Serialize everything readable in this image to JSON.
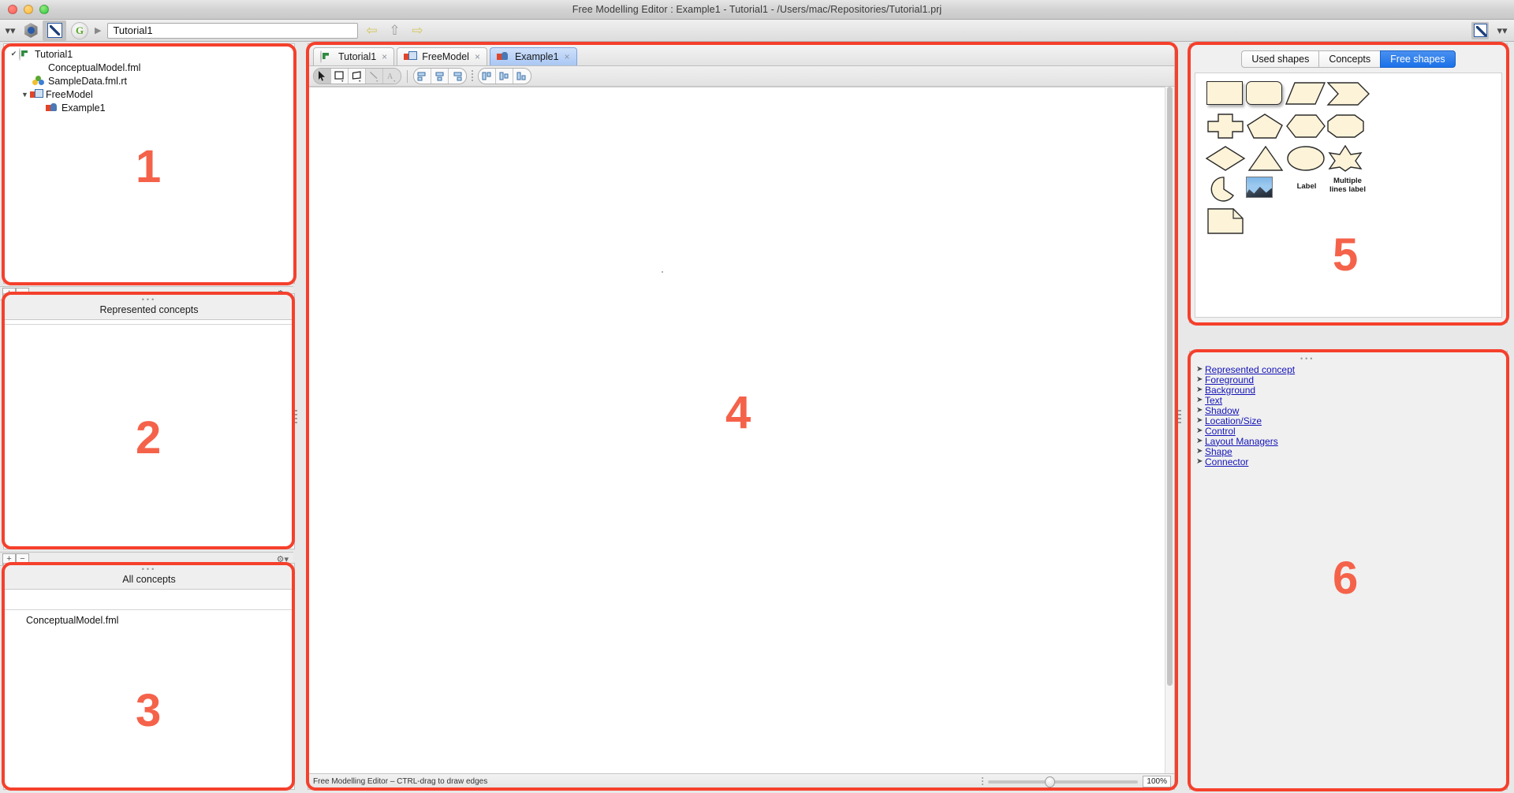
{
  "window": {
    "title": "Free Modelling Editor : Example1 - Tutorial1 - /Users/mac/Repositories/Tutorial1.prj"
  },
  "toolbar": {
    "path_value": "Tutorial1",
    "chevron_icon": "double-chevron-down-icon",
    "cube_icon": "cube-app-icon",
    "pen_icon": "pen-editor-icon",
    "g_icon": "g-badge-icon",
    "expand_arrow": "▶",
    "back_icon": "⇦",
    "up_icon": "⇧",
    "forward_icon": "⇨"
  },
  "annotations": {
    "n1": "1",
    "n2": "2",
    "n3": "3",
    "n4": "4",
    "n5": "5",
    "n6": "6"
  },
  "project_tree": {
    "items": [
      {
        "label": "Tutorial1",
        "icon": "project-icon",
        "depth": 0,
        "twist": "✔"
      },
      {
        "label": "ConceptualModel.fml",
        "icon": "fml-model-icon",
        "depth": 1,
        "twist": ""
      },
      {
        "label": "SampleData.fml.rt",
        "icon": "runtime-data-icon",
        "depth": 1,
        "twist": ""
      },
      {
        "label": "FreeModel",
        "icon": "free-model-icon",
        "depth": 0,
        "twist": "▼"
      },
      {
        "label": "Example1",
        "icon": "diagram-icon",
        "depth": 1,
        "twist": ""
      }
    ]
  },
  "represented_concepts": {
    "title": "Represented concepts",
    "items": []
  },
  "all_concepts": {
    "title": "All concepts",
    "items": [
      {
        "label": "ConceptualModel.fml",
        "icon": "fml-model-icon"
      }
    ]
  },
  "editor": {
    "tabs": [
      {
        "label": "Tutorial1",
        "icon": "project-icon",
        "active": false,
        "close": "×"
      },
      {
        "label": "FreeModel",
        "icon": "free-model-icon",
        "active": false,
        "close": "×"
      },
      {
        "label": "Example1",
        "icon": "diagram-icon",
        "active": true,
        "close": "×"
      }
    ],
    "tools": [
      {
        "name": "select-tool",
        "glyph": "➤",
        "state": "on"
      },
      {
        "name": "rectangle-tool",
        "glyph": "▭",
        "state": "off"
      },
      {
        "name": "polygon-tool",
        "glyph": "⬠",
        "state": "off"
      },
      {
        "name": "line-tool",
        "glyph": "╲",
        "state": "dim"
      },
      {
        "name": "text-tool",
        "glyph": "A",
        "state": "dim"
      }
    ],
    "align_tools": [
      {
        "name": "align-left-icon",
        "glyph": "≡"
      },
      {
        "name": "align-center-icon",
        "glyph": "≡"
      },
      {
        "name": "align-right-icon",
        "glyph": "≡"
      }
    ],
    "distribute_tools": [
      {
        "name": "distribute-top-icon",
        "glyph": "‖"
      },
      {
        "name": "distribute-middle-icon",
        "glyph": "‖"
      },
      {
        "name": "distribute-bottom-icon",
        "glyph": "‖"
      }
    ],
    "status_text": "Free Modelling Editor – CTRL-drag to draw edges",
    "zoom_value": "100%"
  },
  "palette": {
    "tabs": [
      {
        "label": "Used shapes",
        "active": false
      },
      {
        "label": "Concepts",
        "active": false
      },
      {
        "label": "Free shapes",
        "active": true
      }
    ],
    "shapes": [
      {
        "name": "rectangle-shape",
        "kind": "rect",
        "row": 0,
        "col": 0
      },
      {
        "name": "rounded-rectangle-shape",
        "kind": "rounded",
        "row": 0,
        "col": 1
      },
      {
        "name": "parallelogram-shape",
        "kind": "parallel",
        "row": 0,
        "col": 2
      },
      {
        "name": "chevron-shape",
        "kind": "chevron",
        "row": 0,
        "col": 3
      },
      {
        "name": "plus-shape",
        "kind": "plus",
        "row": 1,
        "col": 0
      },
      {
        "name": "pentagon-shape",
        "kind": "pentagon",
        "row": 1,
        "col": 1
      },
      {
        "name": "hexagon-shape",
        "kind": "hexagon",
        "row": 1,
        "col": 2
      },
      {
        "name": "octagon-shape",
        "kind": "octagon",
        "row": 1,
        "col": 3
      },
      {
        "name": "diamond-shape",
        "kind": "diamond",
        "row": 2,
        "col": 0
      },
      {
        "name": "triangle-shape",
        "kind": "triangle",
        "row": 2,
        "col": 1
      },
      {
        "name": "oval-shape",
        "kind": "oval",
        "row": 2,
        "col": 2
      },
      {
        "name": "star-shape",
        "kind": "star",
        "row": 2,
        "col": 3
      },
      {
        "name": "pie-shape",
        "kind": "pie",
        "row": 3,
        "col": 0
      },
      {
        "name": "image-shape",
        "kind": "image",
        "row": 3,
        "col": 1
      },
      {
        "name": "label-shape",
        "kind": "label",
        "row": 3,
        "col": 2
      },
      {
        "name": "multiline-label-shape",
        "kind": "mlabel",
        "row": 3,
        "col": 3
      },
      {
        "name": "note-shape",
        "kind": "note",
        "row": 4,
        "col": 0
      }
    ],
    "label_text": "Label",
    "multiline_label_line1": "Multiple",
    "multiline_label_line2": "lines label"
  },
  "properties": {
    "items": [
      {
        "label": "Represented concept"
      },
      {
        "label": "Foreground"
      },
      {
        "label": "Background"
      },
      {
        "label": "Text"
      },
      {
        "label": "Shadow"
      },
      {
        "label": "Location/Size"
      },
      {
        "label": "Control"
      },
      {
        "label": "Layout Managers"
      },
      {
        "label": "Shape"
      },
      {
        "label": "Connector"
      }
    ]
  },
  "colors": {
    "annotation": "#f5402c",
    "accent": "#1a72e8",
    "shape_fill": "#fdf3d8",
    "link": "#1414b8"
  }
}
